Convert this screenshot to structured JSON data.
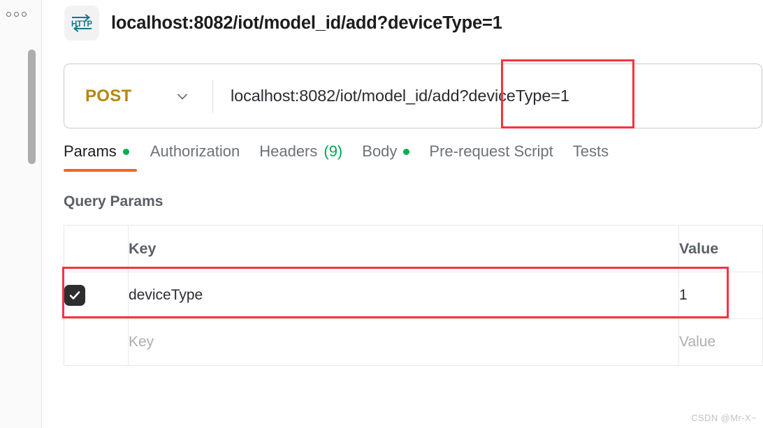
{
  "window": {
    "title": "localhost:8082/iot/model_id/add?deviceType=1",
    "icon": "http-icon"
  },
  "sidebar": {
    "menu_icon": "three-dots-icon",
    "scrollbar": "vertical-scrollbar"
  },
  "request": {
    "method": "POST",
    "method_color": "#b8860b",
    "url": "localhost:8082/iot/model_id/add?deviceType=1",
    "dropdown_icon": "chevron-down-icon"
  },
  "highlights": {
    "url_param_box_color": "#f5333f",
    "param_row_box_color": "#f5333f"
  },
  "tabs": [
    {
      "label": "Params",
      "indicator": "dot",
      "active": true
    },
    {
      "label": "Authorization",
      "indicator": "none",
      "active": false
    },
    {
      "label": "Headers",
      "count": "(9)",
      "indicator": "count",
      "active": false
    },
    {
      "label": "Body",
      "indicator": "dot",
      "active": false
    },
    {
      "label": "Pre-request Script",
      "indicator": "none",
      "active": false
    },
    {
      "label": "Tests",
      "indicator": "none",
      "active": false
    }
  ],
  "tab_accent_color": "#f26522",
  "indicator_color": "#00b04f",
  "query_params": {
    "section_title": "Query Params",
    "columns": {
      "key": "Key",
      "value": "Value"
    },
    "rows": [
      {
        "checked": true,
        "key": "deviceType",
        "value": "1",
        "key_placeholder": "",
        "value_placeholder": ""
      },
      {
        "checked": false,
        "key": "",
        "value": "",
        "key_placeholder": "Key",
        "value_placeholder": "Value"
      }
    ]
  },
  "watermark": "CSDN @Mr-X~"
}
